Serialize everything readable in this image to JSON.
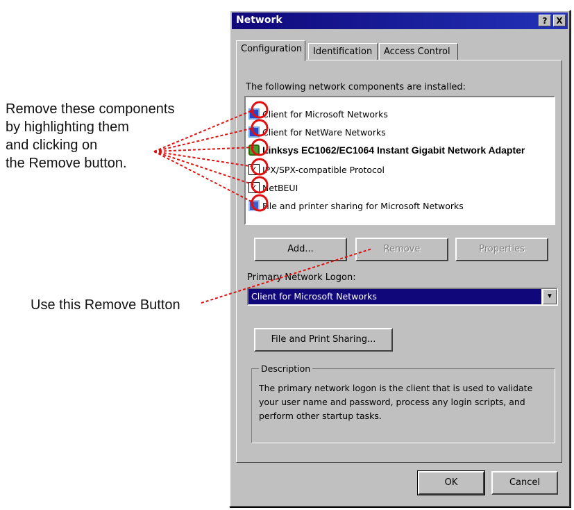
{
  "annotations": {
    "remove_lines": [
      "Remove these components",
      "by highlighting them",
      "and clicking on",
      "the Remove button."
    ],
    "use_button": "Use this Remove Button"
  },
  "dialog": {
    "title": "Network",
    "help_glyph": "?",
    "close_glyph": "X",
    "tabs": [
      "Configuration",
      "Identification",
      "Access Control"
    ],
    "installed_label": "The following network components are installed:",
    "components": [
      {
        "icon": "client-icon",
        "label": "Client for Microsoft Networks"
      },
      {
        "icon": "client-icon",
        "label": "Client for NetWare Networks"
      },
      {
        "icon": "network-adapter-icon",
        "label": "Linksys EC1062/EC1064 Instant Gigabit Network Adapter"
      },
      {
        "icon": "protocol-icon",
        "label": "IPX/SPX-compatible Protocol"
      },
      {
        "icon": "protocol-icon",
        "label": "NetBEUI"
      },
      {
        "icon": "service-icon",
        "label": "File and printer sharing for Microsoft Networks"
      }
    ],
    "buttons": {
      "add": "Add...",
      "remove": "Remove",
      "properties": "Properties",
      "file_print_sharing": "File and Print Sharing...",
      "ok": "OK",
      "cancel": "Cancel"
    },
    "primary_logon_label": "Primary Network Logon:",
    "primary_logon_value": "Client for Microsoft Networks",
    "description_title": "Description",
    "description_text": "The primary network logon is the client that is used to validate your user name and password, process any login scripts, and perform other startup tasks."
  },
  "colors": {
    "titlebar": "#10087a",
    "callout": "#e01010",
    "dialog_bg": "#c0c0c0"
  }
}
